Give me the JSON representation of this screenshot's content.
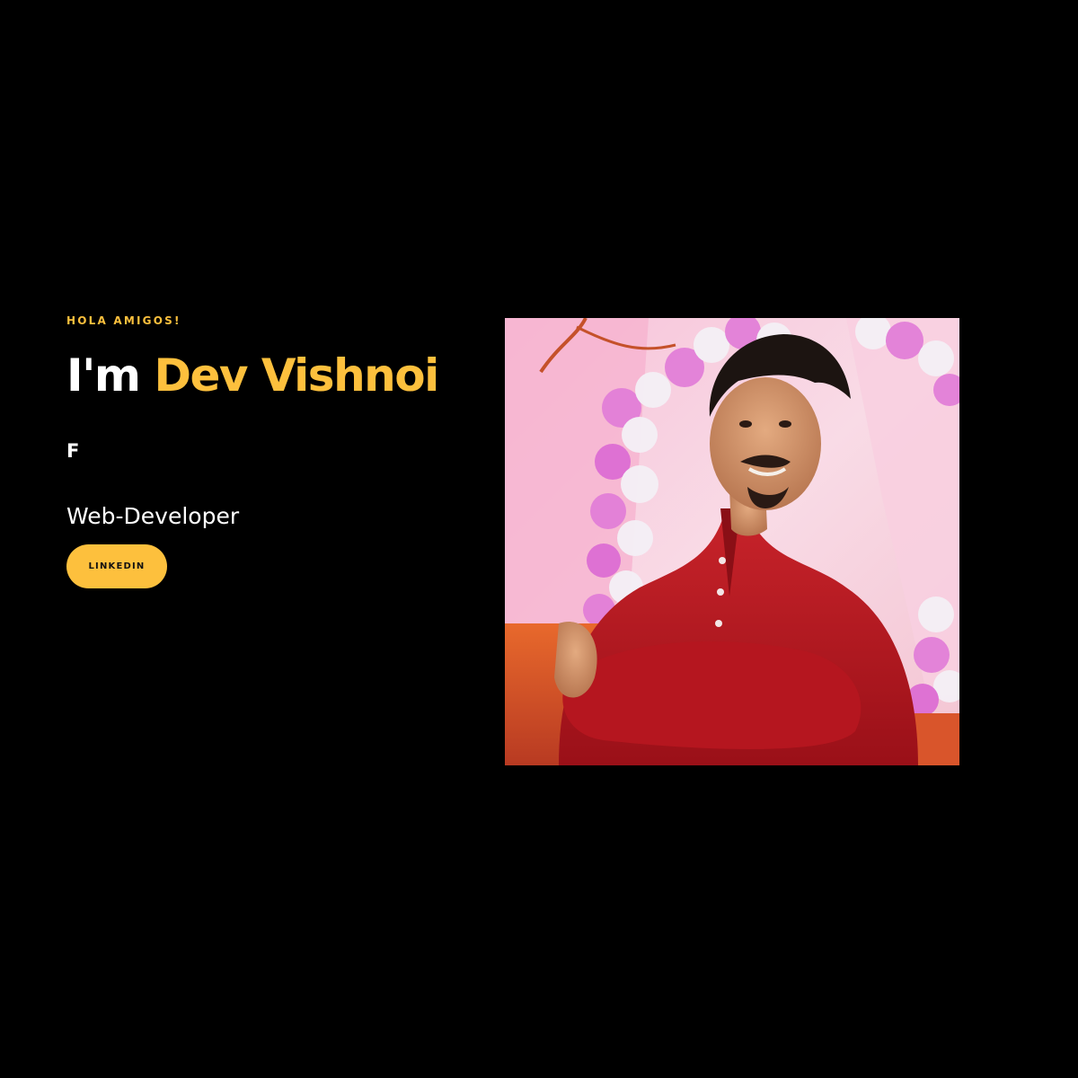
{
  "hero": {
    "greeting": "HOLA AMIGOS!",
    "headline_prefix": "I'm",
    "headline_name": "Dev Vishnoi",
    "typed_text": "F",
    "role": "Web-Developer",
    "linkedin_label": "LINKEDIN"
  },
  "colors": {
    "background": "#000000",
    "accent": "#FDC03D",
    "text": "#FFFFFF"
  },
  "photo": {
    "description_icon": "profile-photo"
  }
}
